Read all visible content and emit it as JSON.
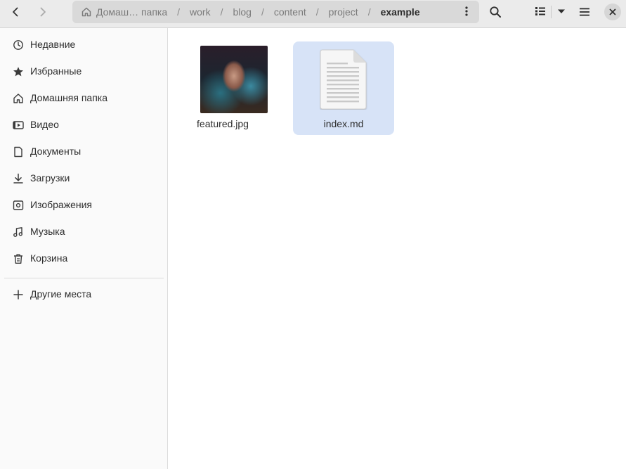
{
  "header": {
    "back_icon": "chevron-left-icon",
    "forward_icon": "chevron-right-icon",
    "path": [
      {
        "label": "Домаш… папка",
        "icon": "home-icon"
      },
      {
        "label": "work"
      },
      {
        "label": "blog"
      },
      {
        "label": "content"
      },
      {
        "label": "project"
      },
      {
        "label": "example",
        "current": true
      }
    ],
    "separator": "/",
    "path_menu_icon": "vertical-dots-icon",
    "search_icon": "search-icon",
    "view_icon": "list-view-icon",
    "view_dropdown_icon": "triangle-down-icon",
    "menu_icon": "hamburger-menu-icon",
    "close_icon": "close-icon"
  },
  "sidebar": {
    "items": [
      {
        "label": "Недавние",
        "icon": "clock-icon"
      },
      {
        "label": "Избранные",
        "icon": "star-icon"
      },
      {
        "label": "Домашняя папка",
        "icon": "home-icon"
      },
      {
        "label": "Видео",
        "icon": "video-icon"
      },
      {
        "label": "Документы",
        "icon": "document-icon"
      },
      {
        "label": "Загрузки",
        "icon": "download-icon"
      },
      {
        "label": "Изображения",
        "icon": "image-icon"
      },
      {
        "label": "Музыка",
        "icon": "music-icon"
      },
      {
        "label": "Корзина",
        "icon": "trash-icon"
      }
    ],
    "other_places": {
      "label": "Другие места",
      "icon": "plus-icon"
    }
  },
  "files": [
    {
      "name": "featured.jpg",
      "type": "image",
      "selected": false
    },
    {
      "name": "index.md",
      "type": "text-document",
      "selected": true
    }
  ],
  "colors": {
    "selection": "#d7e3f7",
    "headerbar": "#ebebeb",
    "sidebar": "#fafafa"
  }
}
